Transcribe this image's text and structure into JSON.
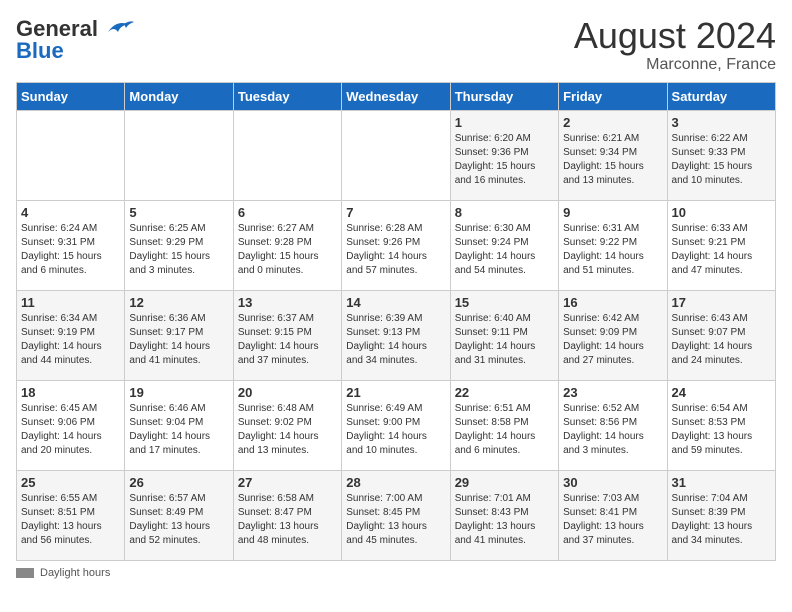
{
  "header": {
    "logo_line1": "General",
    "logo_line2": "Blue",
    "month": "August 2024",
    "location": "Marconne, France"
  },
  "days_of_week": [
    "Sunday",
    "Monday",
    "Tuesday",
    "Wednesday",
    "Thursday",
    "Friday",
    "Saturday"
  ],
  "weeks": [
    [
      {
        "day": "",
        "info": ""
      },
      {
        "day": "",
        "info": ""
      },
      {
        "day": "",
        "info": ""
      },
      {
        "day": "",
        "info": ""
      },
      {
        "day": "1",
        "info": "Sunrise: 6:20 AM\nSunset: 9:36 PM\nDaylight: 15 hours\nand 16 minutes."
      },
      {
        "day": "2",
        "info": "Sunrise: 6:21 AM\nSunset: 9:34 PM\nDaylight: 15 hours\nand 13 minutes."
      },
      {
        "day": "3",
        "info": "Sunrise: 6:22 AM\nSunset: 9:33 PM\nDaylight: 15 hours\nand 10 minutes."
      }
    ],
    [
      {
        "day": "4",
        "info": "Sunrise: 6:24 AM\nSunset: 9:31 PM\nDaylight: 15 hours\nand 6 minutes."
      },
      {
        "day": "5",
        "info": "Sunrise: 6:25 AM\nSunset: 9:29 PM\nDaylight: 15 hours\nand 3 minutes."
      },
      {
        "day": "6",
        "info": "Sunrise: 6:27 AM\nSunset: 9:28 PM\nDaylight: 15 hours\nand 0 minutes."
      },
      {
        "day": "7",
        "info": "Sunrise: 6:28 AM\nSunset: 9:26 PM\nDaylight: 14 hours\nand 57 minutes."
      },
      {
        "day": "8",
        "info": "Sunrise: 6:30 AM\nSunset: 9:24 PM\nDaylight: 14 hours\nand 54 minutes."
      },
      {
        "day": "9",
        "info": "Sunrise: 6:31 AM\nSunset: 9:22 PM\nDaylight: 14 hours\nand 51 minutes."
      },
      {
        "day": "10",
        "info": "Sunrise: 6:33 AM\nSunset: 9:21 PM\nDaylight: 14 hours\nand 47 minutes."
      }
    ],
    [
      {
        "day": "11",
        "info": "Sunrise: 6:34 AM\nSunset: 9:19 PM\nDaylight: 14 hours\nand 44 minutes."
      },
      {
        "day": "12",
        "info": "Sunrise: 6:36 AM\nSunset: 9:17 PM\nDaylight: 14 hours\nand 41 minutes."
      },
      {
        "day": "13",
        "info": "Sunrise: 6:37 AM\nSunset: 9:15 PM\nDaylight: 14 hours\nand 37 minutes."
      },
      {
        "day": "14",
        "info": "Sunrise: 6:39 AM\nSunset: 9:13 PM\nDaylight: 14 hours\nand 34 minutes."
      },
      {
        "day": "15",
        "info": "Sunrise: 6:40 AM\nSunset: 9:11 PM\nDaylight: 14 hours\nand 31 minutes."
      },
      {
        "day": "16",
        "info": "Sunrise: 6:42 AM\nSunset: 9:09 PM\nDaylight: 14 hours\nand 27 minutes."
      },
      {
        "day": "17",
        "info": "Sunrise: 6:43 AM\nSunset: 9:07 PM\nDaylight: 14 hours\nand 24 minutes."
      }
    ],
    [
      {
        "day": "18",
        "info": "Sunrise: 6:45 AM\nSunset: 9:06 PM\nDaylight: 14 hours\nand 20 minutes."
      },
      {
        "day": "19",
        "info": "Sunrise: 6:46 AM\nSunset: 9:04 PM\nDaylight: 14 hours\nand 17 minutes."
      },
      {
        "day": "20",
        "info": "Sunrise: 6:48 AM\nSunset: 9:02 PM\nDaylight: 14 hours\nand 13 minutes."
      },
      {
        "day": "21",
        "info": "Sunrise: 6:49 AM\nSunset: 9:00 PM\nDaylight: 14 hours\nand 10 minutes."
      },
      {
        "day": "22",
        "info": "Sunrise: 6:51 AM\nSunset: 8:58 PM\nDaylight: 14 hours\nand 6 minutes."
      },
      {
        "day": "23",
        "info": "Sunrise: 6:52 AM\nSunset: 8:56 PM\nDaylight: 14 hours\nand 3 minutes."
      },
      {
        "day": "24",
        "info": "Sunrise: 6:54 AM\nSunset: 8:53 PM\nDaylight: 13 hours\nand 59 minutes."
      }
    ],
    [
      {
        "day": "25",
        "info": "Sunrise: 6:55 AM\nSunset: 8:51 PM\nDaylight: 13 hours\nand 56 minutes."
      },
      {
        "day": "26",
        "info": "Sunrise: 6:57 AM\nSunset: 8:49 PM\nDaylight: 13 hours\nand 52 minutes."
      },
      {
        "day": "27",
        "info": "Sunrise: 6:58 AM\nSunset: 8:47 PM\nDaylight: 13 hours\nand 48 minutes."
      },
      {
        "day": "28",
        "info": "Sunrise: 7:00 AM\nSunset: 8:45 PM\nDaylight: 13 hours\nand 45 minutes."
      },
      {
        "day": "29",
        "info": "Sunrise: 7:01 AM\nSunset: 8:43 PM\nDaylight: 13 hours\nand 41 minutes."
      },
      {
        "day": "30",
        "info": "Sunrise: 7:03 AM\nSunset: 8:41 PM\nDaylight: 13 hours\nand 37 minutes."
      },
      {
        "day": "31",
        "info": "Sunrise: 7:04 AM\nSunset: 8:39 PM\nDaylight: 13 hours\nand 34 minutes."
      }
    ]
  ],
  "footer": {
    "daylight_label": "Daylight hours"
  }
}
